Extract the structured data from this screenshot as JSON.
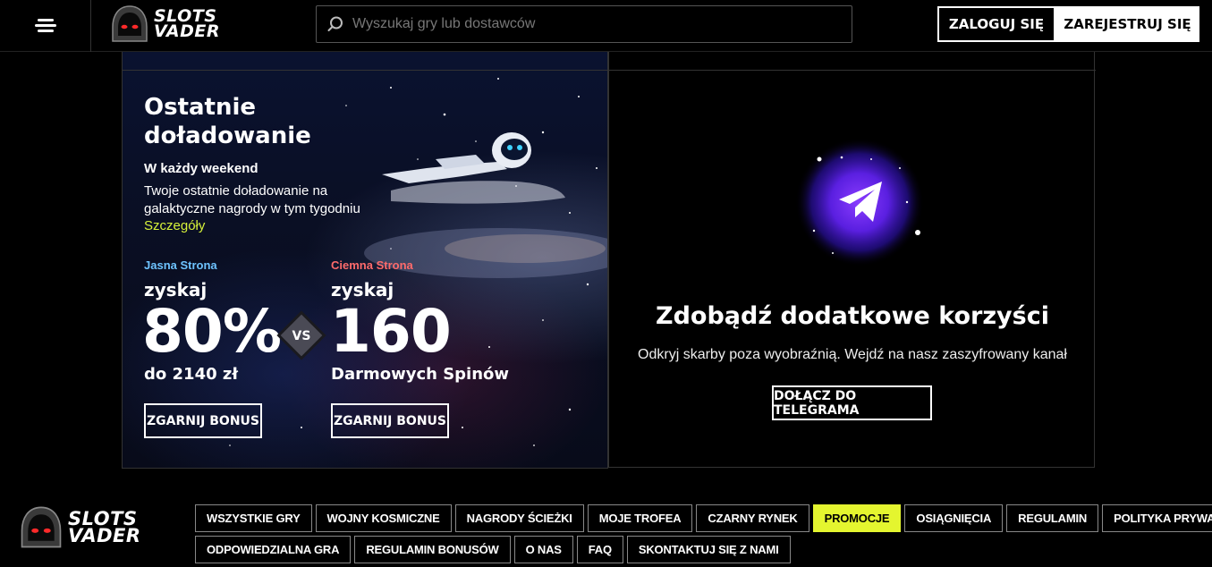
{
  "header": {
    "logo_line1": "SLOTS",
    "logo_line2": "VADER",
    "search_placeholder": "Wyszukaj gry lub dostawców",
    "login_label": "ZALOGUJ SIĘ",
    "register_label": "ZAREJESTRUJ SIĘ"
  },
  "promo": {
    "title": "Ostatnie doładowanie",
    "subtitle": "W każdy weekend",
    "description": "Twoje ostatnie doładowanie na galaktyczne nagrody w tym tygodniu",
    "details_link": "Szczegóły",
    "light_side": {
      "label": "Jasna Strona",
      "win": "zyskaj",
      "value": "80%",
      "amount": "do 2140 zł",
      "button": "ZGARNIJ BONUS"
    },
    "vs": "VS",
    "dark_side": {
      "label": "Ciemna Strona",
      "win": "zyskaj",
      "value": "160",
      "amount": "Darmowych Spinów",
      "button": "ZGARNIJ BONUS"
    }
  },
  "telegram": {
    "title": "Zdobądź dodatkowe korzyści",
    "description": "Odkryj skarby poza wyobraźnią. Wejdź na nasz zaszyfrowany kanał",
    "button": "DOŁĄCZ DO TELEGRAMA"
  },
  "footer": {
    "logo_line1": "SLOTS",
    "logo_line2": "VADER",
    "nav_row1": [
      "WSZYSTKIE GRY",
      "WOJNY KOSMICZNE",
      "NAGRODY ŚCIEŻKI",
      "MOJE TROFEA",
      "CZARNY RYNEK",
      "PROMOCJE",
      "OSIĄGNIĘCIA",
      "REGULAMIN",
      "POLITYKA PRYWATNOŚCI"
    ],
    "nav_row2": [
      "ODPOWIEDZIALNA GRA",
      "REGULAMIN BONUSÓW",
      "O NAS",
      "FAQ",
      "SKONTAKTUJ SIĘ Z NAMI"
    ],
    "active_item": "PROMOCJE"
  },
  "colors": {
    "accent": "#e4f52f",
    "light_side": "#6ec3ff",
    "dark_side": "#ff6b6b",
    "background": "#000000"
  }
}
